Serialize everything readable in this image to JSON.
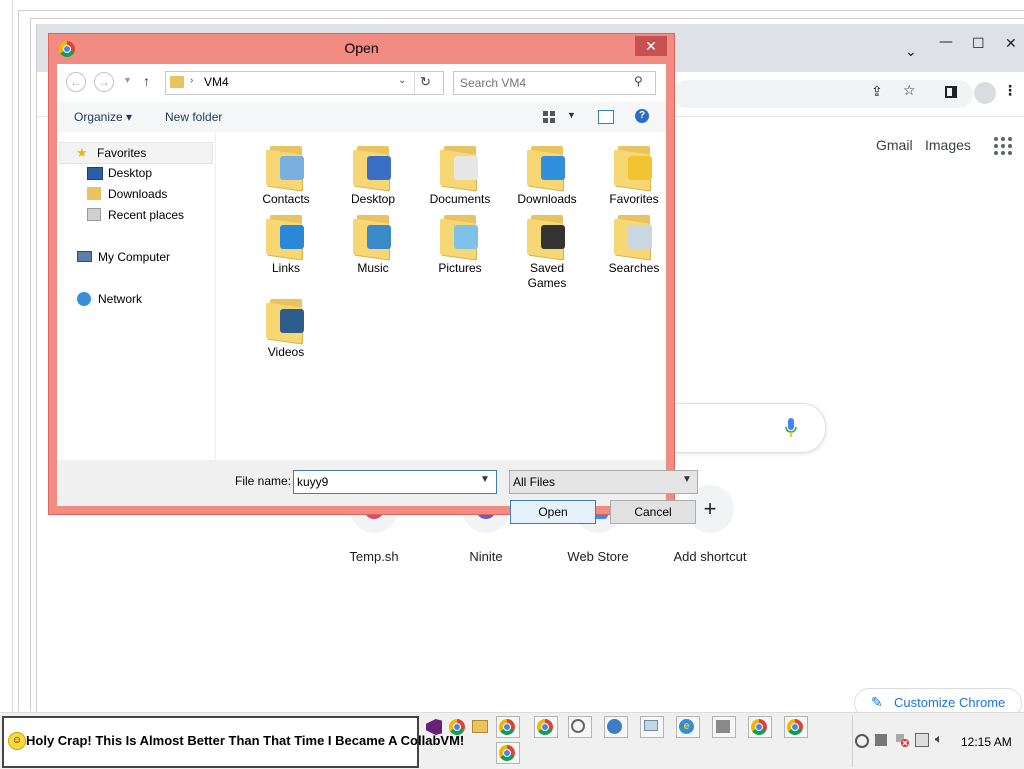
{
  "dialog": {
    "title": "Open",
    "close_glyph": "✕",
    "address": {
      "path": [
        "VM4"
      ]
    },
    "search": {
      "placeholder": "Search VM4"
    },
    "commands": {
      "organize": "Organize ▾",
      "new_folder": "New folder"
    },
    "tree": [
      {
        "label": "Favorites",
        "icon": "star-icon"
      },
      {
        "label": "Desktop",
        "icon": "desktop-icon"
      },
      {
        "label": "Downloads",
        "icon": "downloads-icon"
      },
      {
        "label": "Recent places",
        "icon": "recent-icon"
      },
      {
        "label": "My Computer",
        "icon": "computer-icon"
      },
      {
        "label": "Network",
        "icon": "network-icon"
      }
    ],
    "files": [
      {
        "label": "Contacts",
        "badge": "#7ab0e0"
      },
      {
        "label": "Desktop",
        "badge": "#3a6fc8"
      },
      {
        "label": "Documents",
        "badge": "#e6e6e6"
      },
      {
        "label": "Downloads",
        "badge": "#2f8fdc"
      },
      {
        "label": "Favorites",
        "badge": "#f2c431"
      },
      {
        "label": "Links",
        "badge": "#2b88d8"
      },
      {
        "label": "Music",
        "badge": "#3a89c9"
      },
      {
        "label": "Pictures",
        "badge": "#7fc2e8"
      },
      {
        "label": "Saved Games",
        "badge": "#333333"
      },
      {
        "label": "Searches",
        "badge": "#c9d7e3"
      },
      {
        "label": "Videos",
        "badge": "#2d5d8b"
      }
    ],
    "file_name_label": "File name:",
    "file_name_value": "kuyy9",
    "file_type": "All Files",
    "open_button": "Open",
    "cancel_button": "Cancel"
  },
  "chrome": {
    "links": {
      "gmail": "Gmail",
      "images": "Images"
    },
    "shortcuts": [
      {
        "label": "Temp.sh",
        "color": "#d94a6b"
      },
      {
        "label": "Ninite",
        "color": "#6a5acd"
      },
      {
        "label": "Web Store",
        "color": "#4285f4"
      },
      {
        "label": "Add shortcut",
        "glyph": "+"
      }
    ],
    "customize": "Customize Chrome"
  },
  "taskbar": {
    "banner": "Holy Crap! This Is Almost Better Than That Time I Became A CollabVM!",
    "clock": "12:15 AM"
  },
  "colors": {
    "dialog_frame": "#f28b82",
    "accent_blue": "#1a73e8"
  }
}
